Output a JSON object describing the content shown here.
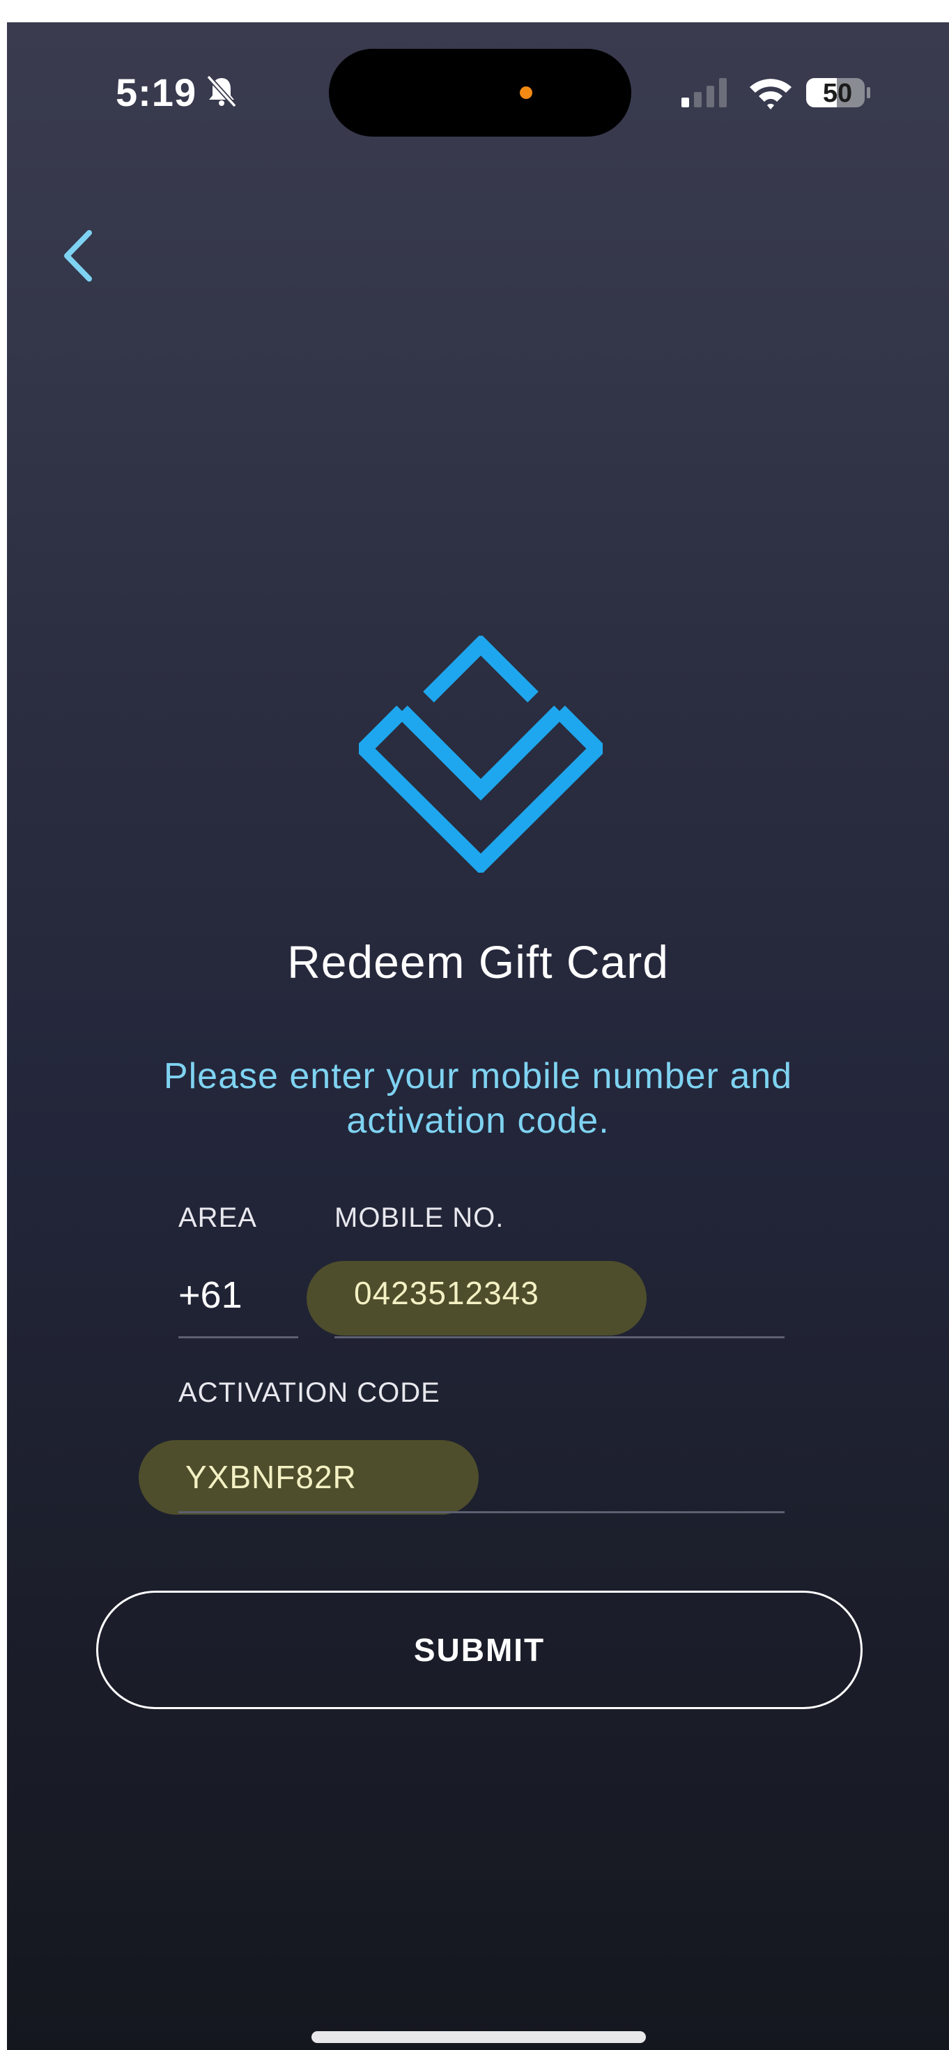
{
  "status_bar": {
    "time": "5:19",
    "battery": "50",
    "icons": [
      "bell-slash-icon",
      "signal-icon",
      "wifi-icon",
      "battery-icon"
    ]
  },
  "navigation": {
    "back_icon": "chevron-left-icon"
  },
  "logo": {
    "icon": "diamond-logo-icon",
    "color": "#1ea7ee"
  },
  "page": {
    "title": "Redeem Gift Card",
    "subtitle_line1": "Please enter your mobile number and",
    "subtitle_line2": "activation code."
  },
  "form": {
    "area_label": "AREA",
    "area_value": "+61",
    "mobile_label": "MOBILE NO.",
    "mobile_value": "0423512343",
    "activation_label": "ACTIVATION CODE",
    "activation_value": "YXBNF82R",
    "submit_label": "SUBMIT"
  },
  "colors": {
    "accent": "#7fd3f2",
    "brand": "#1ea7ee",
    "highlight": "#4e4e2c"
  }
}
